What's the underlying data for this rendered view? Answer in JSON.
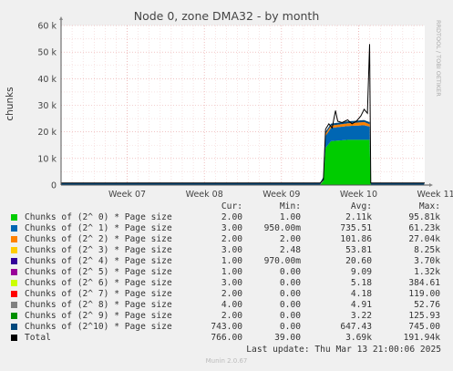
{
  "title": "Node 0, zone DMA32 - by month",
  "side_label": "RRDTOOL / TOBI OETIKER",
  "version": "Munin 2.0.67",
  "last_update": "Last update: Thu Mar 13 21:00:06 2025",
  "legend_headers": [
    "Cur:",
    "Min:",
    "Avg:",
    "Max:"
  ],
  "legend": [
    {
      "name": "Chunks of (2^ 0) * Page size",
      "color": "#00cc00",
      "cur": "2.00",
      "min": "1.00",
      "avg": "2.11k",
      "max": "95.81k"
    },
    {
      "name": "Chunks of (2^ 1) * Page size",
      "color": "#0066b3",
      "cur": "3.00",
      "min": "950.00m",
      "avg": "735.51",
      "max": "61.23k"
    },
    {
      "name": "Chunks of (2^ 2) * Page size",
      "color": "#ff8000",
      "cur": "2.00",
      "min": "2.00",
      "avg": "101.86",
      "max": "27.04k"
    },
    {
      "name": "Chunks of (2^ 3) * Page size",
      "color": "#ffcc00",
      "cur": "3.00",
      "min": "2.48",
      "avg": "53.81",
      "max": "8.25k"
    },
    {
      "name": "Chunks of (2^ 4) * Page size",
      "color": "#330099",
      "cur": "1.00",
      "min": "970.00m",
      "avg": "20.60",
      "max": "3.70k"
    },
    {
      "name": "Chunks of (2^ 5) * Page size",
      "color": "#990099",
      "cur": "1.00",
      "min": "0.00",
      "avg": "9.09",
      "max": "1.32k"
    },
    {
      "name": "Chunks of (2^ 6) * Page size",
      "color": "#ccff00",
      "cur": "3.00",
      "min": "0.00",
      "avg": "5.18",
      "max": "384.61"
    },
    {
      "name": "Chunks of (2^ 7) * Page size",
      "color": "#ff0000",
      "cur": "2.00",
      "min": "0.00",
      "avg": "4.18",
      "max": "119.00"
    },
    {
      "name": "Chunks of (2^ 8) * Page size",
      "color": "#808080",
      "cur": "4.00",
      "min": "0.00",
      "avg": "4.91",
      "max": "52.76"
    },
    {
      "name": "Chunks of (2^ 9) * Page size",
      "color": "#008f00",
      "cur": "2.00",
      "min": "0.00",
      "avg": "3.22",
      "max": "125.93"
    },
    {
      "name": "Chunks of (2^10) * Page size",
      "color": "#00487d",
      "cur": "743.00",
      "min": "0.00",
      "avg": "647.43",
      "max": "745.00"
    },
    {
      "name": "Total",
      "color": "#000000",
      "cur": "766.00",
      "min": "39.00",
      "avg": "3.69k",
      "max": "191.94k"
    }
  ],
  "chart_data": {
    "type": "area",
    "title": "Node 0, zone DMA32 - by month",
    "ylabel": "chunks",
    "ylim": [
      0,
      60000
    ],
    "yticks": [
      0,
      10000,
      20000,
      30000,
      40000,
      50000,
      60000
    ],
    "ytick_labels": [
      "0",
      "10 k",
      "20 k",
      "30 k",
      "40 k",
      "50 k",
      "60 k"
    ],
    "xlim": [
      0,
      33
    ],
    "xticks": [
      {
        "label": "Week 07",
        "x": 6
      },
      {
        "label": "Week 08",
        "x": 13
      },
      {
        "label": "Week 09",
        "x": 20
      },
      {
        "label": "Week 10",
        "x": 27
      },
      {
        "label": "Week 11",
        "x": 34
      }
    ],
    "grid": true,
    "series": [
      {
        "name": "Chunks of (2^ 0) * Page size",
        "color": "#00cc00",
        "points": [
          [
            0,
            2
          ],
          [
            23.5,
            2
          ],
          [
            23.8,
            1500
          ],
          [
            24.0,
            14000
          ],
          [
            24.5,
            16500
          ],
          [
            26.0,
            17000
          ],
          [
            27.5,
            17000
          ],
          [
            28.0,
            17000
          ],
          [
            28.1,
            2
          ],
          [
            33,
            2
          ]
        ]
      },
      {
        "name": "Chunks of (2^ 1) * Page size",
        "color": "#0066b3",
        "points": [
          [
            0,
            3
          ],
          [
            23.5,
            3
          ],
          [
            23.8,
            300
          ],
          [
            24.0,
            4500
          ],
          [
            24.5,
            5000
          ],
          [
            26.0,
            5200
          ],
          [
            27.5,
            5500
          ],
          [
            28.0,
            5000
          ],
          [
            28.1,
            3
          ],
          [
            33,
            3
          ]
        ]
      },
      {
        "name": "Chunks of (2^ 2) * Page size",
        "color": "#ff8000",
        "points": [
          [
            0,
            2
          ],
          [
            23.5,
            2
          ],
          [
            24.0,
            800
          ],
          [
            26.0,
            1000
          ],
          [
            27.5,
            1200
          ],
          [
            28.0,
            900
          ],
          [
            28.1,
            2
          ],
          [
            33,
            2
          ]
        ]
      },
      {
        "name": "Chunks of (2^10) * Page size",
        "color": "#00487d",
        "points": [
          [
            0,
            743
          ],
          [
            33,
            743
          ]
        ]
      },
      {
        "name": "Total",
        "color": "#000000",
        "points": [
          [
            0,
            766
          ],
          [
            23.5,
            766
          ],
          [
            23.8,
            2000
          ],
          [
            24.0,
            21000
          ],
          [
            24.3,
            23000
          ],
          [
            24.6,
            21500
          ],
          [
            24.9,
            28000
          ],
          [
            25.1,
            24000
          ],
          [
            25.5,
            23500
          ],
          [
            26.0,
            24500
          ],
          [
            26.4,
            23000
          ],
          [
            26.8,
            24000
          ],
          [
            27.2,
            26000
          ],
          [
            27.5,
            28500
          ],
          [
            27.8,
            27000
          ],
          [
            28.0,
            53000
          ],
          [
            28.1,
            766
          ],
          [
            33,
            766
          ]
        ]
      }
    ]
  }
}
